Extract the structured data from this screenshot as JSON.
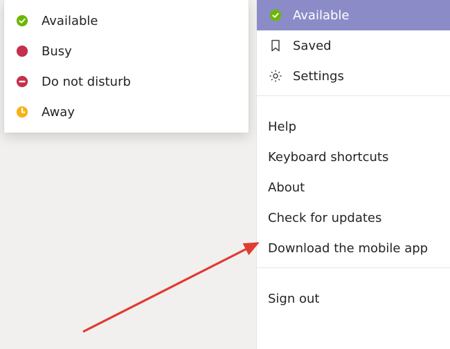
{
  "presence_menu": {
    "items": [
      {
        "label": "Available",
        "status": "available"
      },
      {
        "label": "Busy",
        "status": "busy"
      },
      {
        "label": "Do not disturb",
        "status": "dnd"
      },
      {
        "label": "Away",
        "status": "away"
      }
    ]
  },
  "profile_menu": {
    "top_items": [
      {
        "label": "Available",
        "icon": "presence-available",
        "selected": true
      },
      {
        "label": "Saved",
        "icon": "bookmark"
      },
      {
        "label": "Settings",
        "icon": "gear"
      }
    ],
    "middle_items": [
      {
        "label": "Help"
      },
      {
        "label": "Keyboard shortcuts"
      },
      {
        "label": "About"
      },
      {
        "label": "Check for updates"
      },
      {
        "label": "Download the mobile app"
      }
    ],
    "bottom_items": [
      {
        "label": "Sign out"
      }
    ]
  },
  "annotation": {
    "arrow_color": "#e03c31"
  }
}
